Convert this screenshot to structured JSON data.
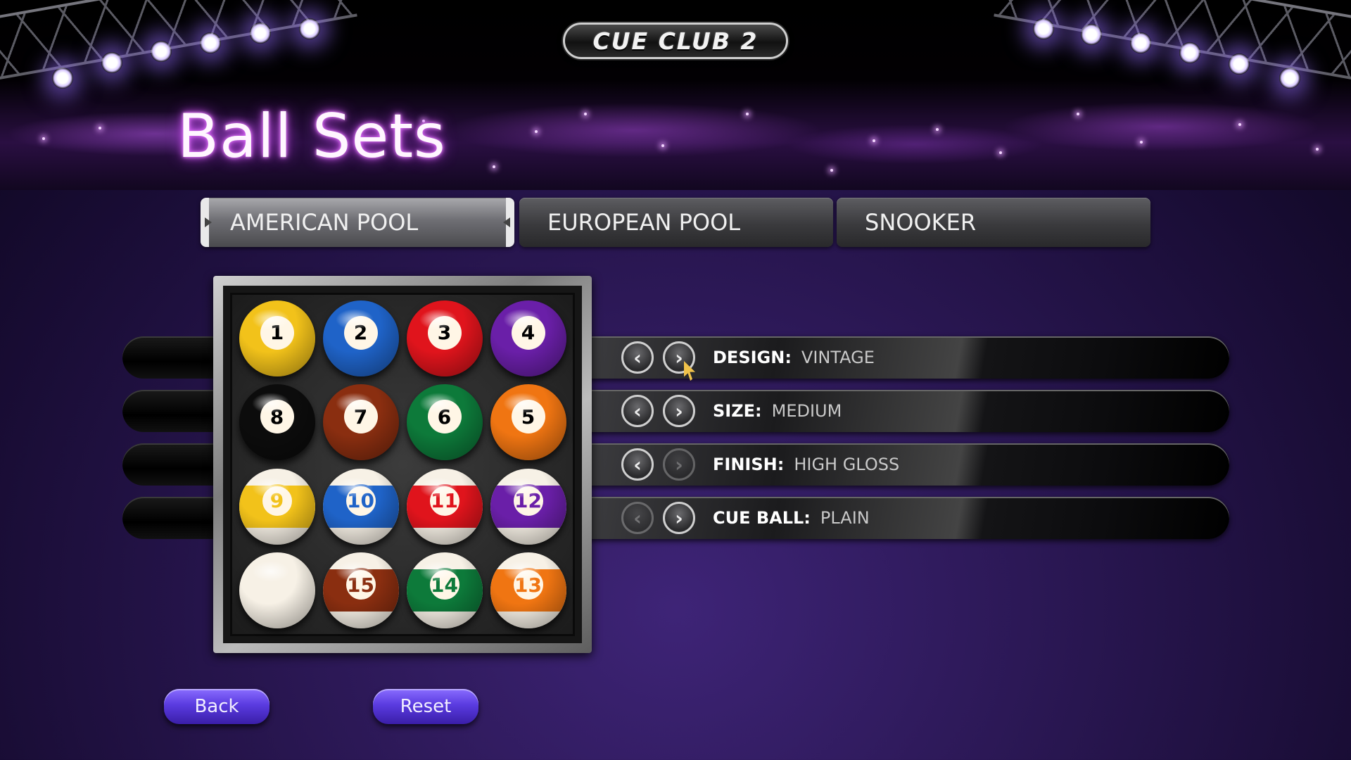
{
  "app": {
    "logo_text": "CUE CLUB 2"
  },
  "header": {
    "title": "Ball Sets"
  },
  "tabs": [
    {
      "label": "AMERICAN POOL",
      "active": true
    },
    {
      "label": "EUROPEAN POOL",
      "active": false
    },
    {
      "label": "SNOOKER",
      "active": false
    }
  ],
  "options": [
    {
      "key": "DESIGN:",
      "value": "VINTAGE",
      "prev_enabled": true,
      "next_enabled": true
    },
    {
      "key": "SIZE:",
      "value": "MEDIUM",
      "prev_enabled": true,
      "next_enabled": true
    },
    {
      "key": "FINISH:",
      "value": "HIGH GLOSS",
      "prev_enabled": true,
      "next_enabled": false
    },
    {
      "key": "CUE BALL:",
      "value": "PLAIN",
      "prev_enabled": false,
      "next_enabled": true
    }
  ],
  "rack": {
    "balls": [
      {
        "number": "1",
        "color": "#f2c21a",
        "stripe": false
      },
      {
        "number": "2",
        "color": "#1f63c8",
        "stripe": false
      },
      {
        "number": "3",
        "color": "#e0141c",
        "stripe": false
      },
      {
        "number": "4",
        "color": "#6a1fa8",
        "stripe": false
      },
      {
        "number": "8",
        "color": "#0c0c0c",
        "stripe": false
      },
      {
        "number": "7",
        "color": "#8a2e10",
        "stripe": false
      },
      {
        "number": "6",
        "color": "#0d7a3a",
        "stripe": false
      },
      {
        "number": "5",
        "color": "#f07512",
        "stripe": false
      },
      {
        "number": "9",
        "color": "#f2c21a",
        "stripe": true
      },
      {
        "number": "10",
        "color": "#1f63c8",
        "stripe": true
      },
      {
        "number": "11",
        "color": "#e0141c",
        "stripe": true
      },
      {
        "number": "12",
        "color": "#6a1fa8",
        "stripe": true
      },
      {
        "number": "",
        "color": "#f7f1e6",
        "stripe": false,
        "cue": true
      },
      {
        "number": "15",
        "color": "#8a2e10",
        "stripe": true
      },
      {
        "number": "14",
        "color": "#0d7a3a",
        "stripe": true
      },
      {
        "number": "13",
        "color": "#f07512",
        "stripe": true
      }
    ]
  },
  "footer": {
    "back_label": "Back",
    "reset_label": "Reset"
  },
  "icons": {
    "prev": "chevron-left-icon",
    "next": "chevron-right-icon",
    "cursor": "mouse-pointer-icon"
  },
  "colors": {
    "title_glow": "#e066ff",
    "button_purple": "#5a3be0"
  }
}
